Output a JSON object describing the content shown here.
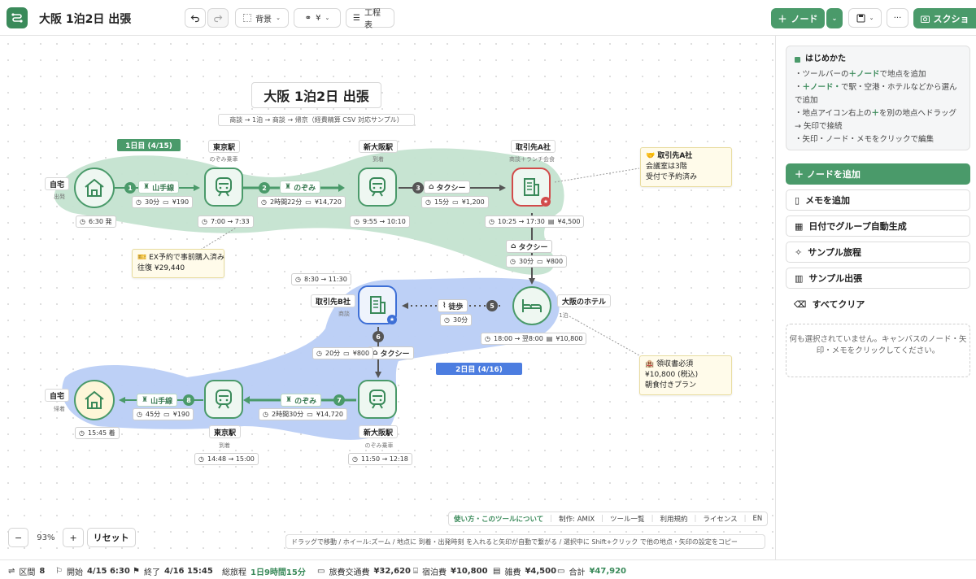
{
  "app": {
    "title": "大阪 1泊2日 出張"
  },
  "toolbar": {
    "background": "背景",
    "currency": "¥",
    "schedule": "工程表",
    "add_node": "ノード",
    "screenshot": "スクショ"
  },
  "canvas": {
    "title": "大阪 1泊2日 出張",
    "subtitle": "商談 → 1泊 → 商談 → 帰京（経費精算 CSV 対応サンプル）",
    "day1": "1日目 (4/15)",
    "day2": "2日目 (4/16)",
    "nodes": {
      "home1": {
        "label": "自宅",
        "sub": "出発",
        "time": "6:30 発"
      },
      "tokyo1": {
        "label": "東京駅",
        "sub": "のぞみ乗車",
        "time": "7:00 → 7:33"
      },
      "shinosaka1": {
        "label": "新大阪駅",
        "sub": "到着",
        "time": "9:55 → 10:10"
      },
      "clientA": {
        "label": "取引先A社",
        "sub": "商談＋ランチ会食",
        "time": "10:25 → 17:30",
        "cost": "¥4,500"
      },
      "hotel": {
        "label": "大阪のホテル",
        "sub": "1泊",
        "time": "18:00 → 翌8:00",
        "cost": "¥10,800"
      },
      "clientB": {
        "label": "取引先B社",
        "sub": "商談",
        "time": "8:30 → 11:30"
      },
      "shinosaka2": {
        "label": "新大阪駅",
        "sub": "のぞみ乗車",
        "time": "11:50 → 12:18"
      },
      "tokyo2": {
        "label": "東京駅",
        "sub": "到着",
        "time": "14:48 → 15:00"
      },
      "home2": {
        "label": "自宅",
        "sub": "帰着",
        "time": "15:45 着"
      }
    },
    "legs": [
      {
        "n": "1",
        "mode": "山手線",
        "dur": "30分",
        "cost": "¥190"
      },
      {
        "n": "2",
        "mode": "のぞみ",
        "dur": "2時間22分",
        "cost": "¥14,720"
      },
      {
        "n": "3",
        "mode": "タクシー",
        "dur": "15分",
        "cost": "¥1,200"
      },
      {
        "n": "4",
        "mode": "タクシー",
        "dur": "30分",
        "cost": "¥800"
      },
      {
        "n": "5",
        "mode": "徒歩",
        "dur": "30分",
        "cost": ""
      },
      {
        "n": "6",
        "mode": "タクシー",
        "dur": "20分",
        "cost": "¥800"
      },
      {
        "n": "7",
        "mode": "のぞみ",
        "dur": "2時間30分",
        "cost": "¥14,720"
      },
      {
        "n": "8",
        "mode": "山手線",
        "dur": "45分",
        "cost": "¥190"
      }
    ],
    "memos": {
      "clientA": [
        "🤝 取引先A社",
        "会議室は3階",
        "受付で予約済み"
      ],
      "ex": [
        "🎫 EX予約で事前購入済み",
        "往復 ¥29,440"
      ],
      "receipt": [
        "🏨 領収書必須",
        "¥10,800 (税込)",
        "朝食付きプラン"
      ]
    }
  },
  "footer": {
    "links": [
      "使い方・このツールについて",
      "制作: AMIX",
      "ツール一覧",
      "利用規約",
      "ライセンス",
      "EN"
    ],
    "hint": "ドラッグで移動 / ホイール:ズーム / 地点に 到着・出発時刻 を入れると矢印が自動で繋がる / 選択中に Shift+クリック で他の地点・矢印の設定をコピー"
  },
  "zoom": {
    "minus": "−",
    "level": "93%",
    "plus": "+",
    "reset": "リセット"
  },
  "sidebar": {
    "help_title": "はじめかた",
    "help_lines": [
      [
        "・ツールバーの",
        "＋ノード",
        "で地点を追加"
      ],
      [
        "・",
        "＋ノード・",
        "で駅・空港・ホテルなどから選んで追加"
      ],
      [
        "・地点アイコン右上の",
        "＋",
        "を別の地点へドラッグ → 矢印で接続"
      ],
      [
        "・矢印・ノード・メモをクリックで編集",
        "",
        ""
      ]
    ],
    "buttons": [
      "＋ ノードを追加",
      "メモを追加",
      "日付でグループ自動生成",
      "サンプル旅程",
      "サンプル出張",
      "すべてクリア"
    ],
    "empty": "何も選択されていません。キャンバスのノード・矢印・メモをクリックしてください。"
  },
  "status": {
    "sections_label": "区間",
    "sections": "8",
    "start_label": "開始",
    "start": "4/15 6:30",
    "end_label": "終了",
    "end": "4/16 15:45",
    "total_label": "総旅程",
    "total": "1日9時間15分",
    "transport_label": "旅費交通費",
    "transport": "¥32,620",
    "lodging_label": "宿泊費",
    "lodging": "¥10,800",
    "misc_label": "雑費",
    "misc": "¥4,500",
    "sum_label": "合計",
    "sum": "¥47,920"
  }
}
